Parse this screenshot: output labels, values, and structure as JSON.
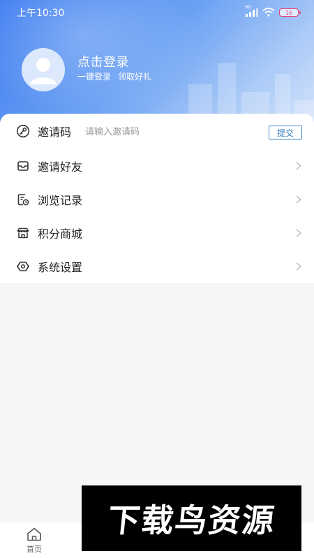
{
  "status_bar": {
    "time": "上午10:30",
    "hd_label": "HD",
    "battery_level": "16"
  },
  "profile": {
    "login_title": "点击登录",
    "subtitle_1": "一键登录",
    "subtitle_2": "领取好礼"
  },
  "invite": {
    "label": "邀请码",
    "placeholder": "请输入邀请码",
    "submit_label": "提交",
    "icon": "key-icon"
  },
  "menu": [
    {
      "label": "邀请好友",
      "icon": "envelope-icon"
    },
    {
      "label": "浏览记录",
      "icon": "history-icon"
    },
    {
      "label": "积分商城",
      "icon": "shop-icon"
    },
    {
      "label": "系统设置",
      "icon": "settings-icon"
    }
  ],
  "bottom_nav": {
    "home_label": "首页",
    "home_icon": "home-icon"
  },
  "watermark": {
    "text": "下载鸟资源"
  },
  "colors": {
    "header_start": "#3d7cf0",
    "header_end": "#d8e6fb",
    "accent": "#3b82c4",
    "battery": "#e9457c",
    "background": "#f6f6f7"
  }
}
